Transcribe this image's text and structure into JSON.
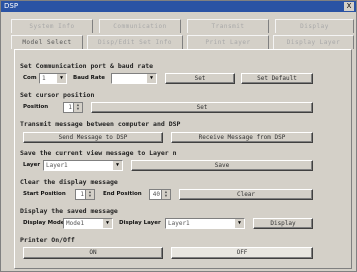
{
  "window": {
    "title": "DSP",
    "close_glyph": "X"
  },
  "tabs_top": [
    "System Info",
    "Communication",
    "Transmit",
    "Display"
  ],
  "tabs_bottom": [
    "Model Select",
    "Disp/Edit Set Info",
    "Print Layer",
    "Display Layer"
  ],
  "sections": {
    "comm": {
      "title": "Set Communication port & baud rate",
      "com_label": "Com",
      "com_value": "1",
      "baud_label": "Baud Rate",
      "baud_value": "",
      "set_button": "Set",
      "default_button": "Set Default"
    },
    "cursor": {
      "title": "Set cursor position",
      "pos_label": "Position",
      "pos_value": "1",
      "set_button": "Set"
    },
    "transmit": {
      "title": "Transmit message between computer and DSP",
      "send_button": "Send Message to DSP",
      "receive_button": "Receive Message from DSP"
    },
    "save": {
      "title": "Save the current view message to Layer n",
      "layer_label": "Layer",
      "layer_value": "Layer1",
      "save_button": "Save"
    },
    "clear": {
      "title": "Clear the display message",
      "start_label": "Start Position",
      "start_value": "1",
      "end_label": "End Position",
      "end_value": "40",
      "clear_button": "Clear"
    },
    "display": {
      "title": "Display the saved message",
      "mode_label": "Display Mode",
      "mode_value": "Mode1",
      "layer_label": "Display Layer",
      "layer_value": "Layer1",
      "display_button": "Display"
    },
    "printer": {
      "title": "Printer On/Off",
      "on_button": "ON",
      "off_button": "OFF"
    }
  }
}
